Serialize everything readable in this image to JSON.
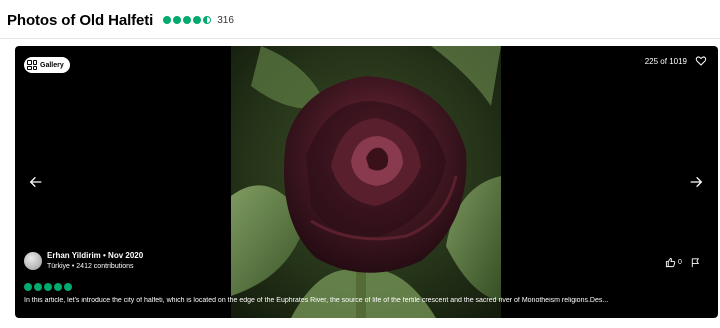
{
  "header": {
    "title": "Photos of Old Halfeti",
    "rating": 4.5,
    "review_count": "316",
    "rating_color": "#00aa6c"
  },
  "viewer": {
    "gallery_label": "Gallery",
    "counter": "225 of 1019",
    "icons": {
      "gallery": "grid-icon",
      "save": "heart-icon",
      "prev": "chevron-left-icon",
      "next": "chevron-right-icon",
      "like": "thumbs-up-icon",
      "report": "flag-icon"
    }
  },
  "photo": {
    "subject": "black-red-rose"
  },
  "review": {
    "author": "Erhan Yildirim • Nov 2020",
    "meta": "Türkiye • 2412 contributions",
    "rating": 5,
    "text": "In this article, let's introduce the city of halfeti, which is located on the edge of the Euphrates River, the source of life of the fertile crescent and the sacred river of Monotheism religions.Des...",
    "likes": "0"
  }
}
